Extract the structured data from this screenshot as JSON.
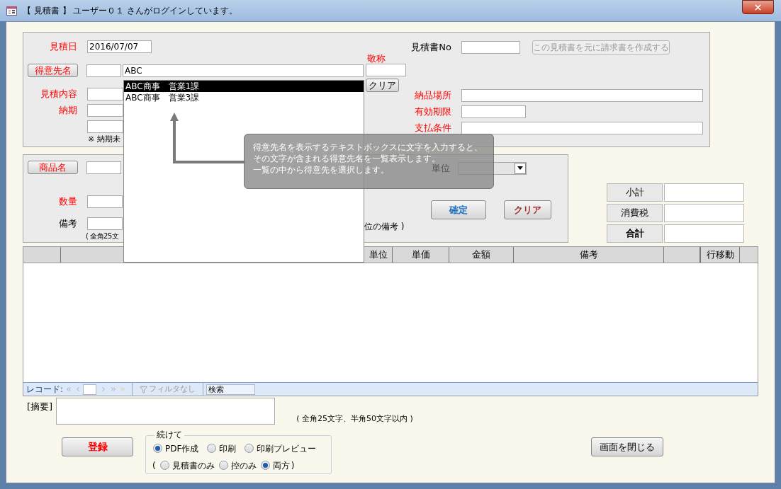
{
  "window": {
    "title": "【 見積書 】 ユーザー０１ さんがログインしています。"
  },
  "estimate_date": {
    "label": "見積日",
    "required": true,
    "value": "2016/07/07"
  },
  "estimate_no": {
    "label": "見積書No",
    "required": false
  },
  "invoice_button": {
    "label": "この見積書を元に請求書を作成する",
    "disabled": true
  },
  "customer": {
    "button": "得意先名",
    "query": "ABC",
    "honorific_label": "敬称",
    "honorific_required": true,
    "clear_button": "クリア",
    "suggestions": [
      {
        "label": "ABC商事　営業1課",
        "selected": true
      },
      {
        "label": "ABC商事　営業3課",
        "selected": false
      }
    ]
  },
  "estimate_content": {
    "label": "見積内容",
    "required": true
  },
  "delivery_date": {
    "label": "納期",
    "required": true
  },
  "delivery_note": "※ 納期未",
  "delivery_place": {
    "label": "納品場所",
    "required": true
  },
  "expiry": {
    "label": "有効期限",
    "required": true
  },
  "payment_terms": {
    "label": "支払条件",
    "required": true
  },
  "item_entry": {
    "product_button": "商品名",
    "unit_label": "単位",
    "quantity": {
      "label": "数量",
      "required": true
    },
    "remarks": {
      "label": "備考",
      "required": false
    },
    "remarks_note": "( 全角25文",
    "unit_remarks_note": "位の備考 )",
    "confirm_button": "確定",
    "clear_button": "クリア"
  },
  "totals": [
    {
      "label": "小計",
      "bold": false
    },
    {
      "label": "消費税",
      "bold": false
    },
    {
      "label": "合計",
      "bold": true
    }
  ],
  "table": {
    "columns": [
      "単位",
      "単価",
      "金額",
      "備考",
      "行移動"
    ]
  },
  "record_nav": {
    "label": "レコード:",
    "filter": "フィルタなし",
    "search": "検索"
  },
  "summary": {
    "label": "[摘要]",
    "note": "( 全角25文字、半角50文字以内 )"
  },
  "register_button": "登録",
  "continue_group": {
    "legend": "続けて",
    "actions": [
      {
        "label": "PDF作成",
        "selected": true
      },
      {
        "label": "印刷",
        "selected": false
      },
      {
        "label": "印刷プレビュー",
        "selected": false
      }
    ],
    "open_paren": "(",
    "targets": [
      {
        "label": "見積書のみ",
        "selected": false
      },
      {
        "label": "控のみ",
        "selected": false
      },
      {
        "label": "両方",
        "selected": true
      }
    ],
    "close_paren": ")"
  },
  "close_button": "画面を閉じる",
  "tooltip_lines": [
    "得意先名を表示するテキストボックスに文字を入力すると、",
    "その文字が含まれる得意先名を一覧表示します。",
    "一覧の中から得意先を選択します。"
  ]
}
